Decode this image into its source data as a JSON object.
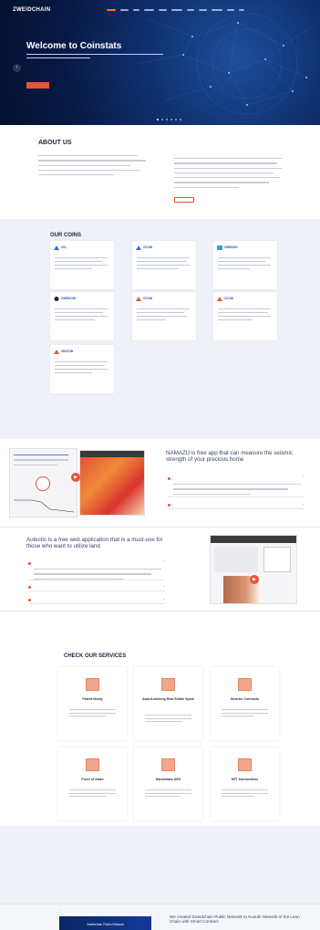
{
  "header": {
    "logo": "ZWEIDCHAIN",
    "nav_count": 11
  },
  "hero": {
    "title": "Welcome to Coinstats",
    "subtitle": "",
    "button": "",
    "slides_total": 6,
    "slides_active": 1
  },
  "about": {
    "heading": "ABOUT US",
    "button": ""
  },
  "coins": {
    "heading": "OUR COINS",
    "items": [
      {
        "name": "ZCL"
      },
      {
        "name": "ZCOIN"
      },
      {
        "name": "ZWEIUSD"
      },
      {
        "name": "ZWEIKOIN"
      },
      {
        "name": "ZCOIN"
      },
      {
        "name": "ZCOIN"
      },
      {
        "name": "ZENTOB"
      }
    ]
  },
  "feature_namazu": {
    "title": "NAMAZU is free app that can measure the seismic strength of your precious home",
    "accordion": [
      "",
      ""
    ]
  },
  "feature_autectic": {
    "title": "Autectic is a free web application that is a must-use for those who want to utilize land",
    "accordion": [
      "",
      "",
      ""
    ]
  },
  "services": {
    "heading": "CHECK OUR SERVICES",
    "items": [
      {
        "name": "Patent family"
      },
      {
        "name": "Award-winning Real Estate Spain"
      },
      {
        "name": "Smarter Contracts"
      },
      {
        "name": "Proof of Stake"
      },
      {
        "name": "Handshake DEX"
      },
      {
        "name": "NFT transactions"
      }
    ]
  },
  "news": {
    "image_caption": "Zweidchain Public Network",
    "title": "We created Zweidchain Public Network to Kusuhi Network of the Lean Chain with Smart Contract"
  },
  "colors": {
    "accent": "#e8533a",
    "hero_dark": "#071a45",
    "brand_blue": "#2650b8"
  }
}
